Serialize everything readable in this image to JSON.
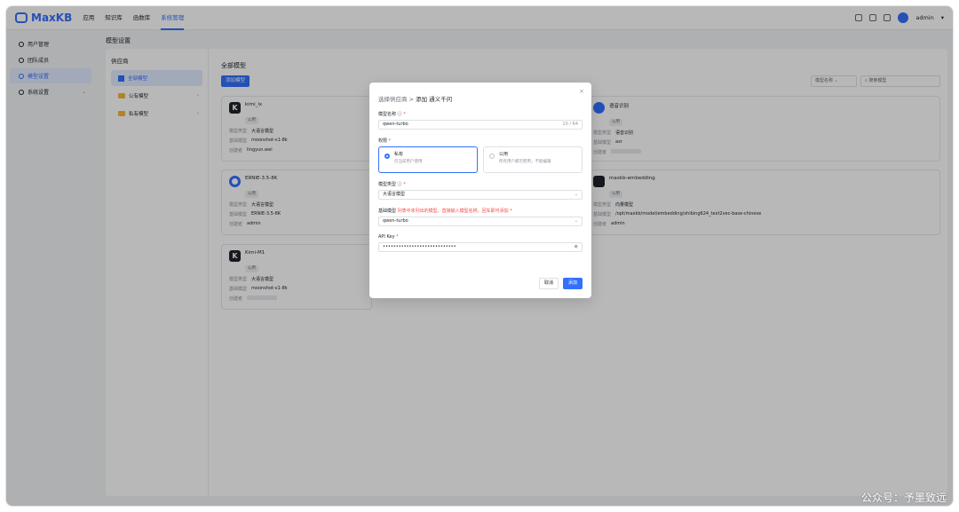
{
  "app": {
    "logo": "MaxKB"
  },
  "topnav": [
    "应用",
    "知识库",
    "函数库",
    "系统管理"
  ],
  "user": {
    "name": "admin"
  },
  "sidebar": {
    "items": [
      {
        "label": "用户管理"
      },
      {
        "label": "团队成员"
      },
      {
        "label": "模型设置"
      },
      {
        "label": "系统设置"
      }
    ]
  },
  "page_title": "模型设置",
  "providers": {
    "title": "供应商",
    "items": [
      {
        "label": "全部模型"
      },
      {
        "label": "公有模型"
      },
      {
        "label": "私有模型"
      }
    ]
  },
  "models": {
    "heading": "全部模型",
    "add_label": "添加模型",
    "filter_label": "模型名称",
    "search_placeholder": "搜索模型",
    "cards": [
      {
        "logo": "K",
        "name": "kimi_lx",
        "tag": "公用",
        "type": "大语言模型",
        "base": "moonshot-v1-8k",
        "creator": "lingyun.wei"
      },
      {
        "logo": "",
        "name": "ERNIE-3.5-8K",
        "tag": "公用",
        "type": "大语言模型",
        "base": "ERNIE-3.5-8K",
        "creator": "admin"
      },
      {
        "logo": "K",
        "name": "Kimi-M1",
        "tag": "公用",
        "type": "大语言模型",
        "base": "moonshot-v1-8k",
        "creator": ""
      },
      {
        "logo": "",
        "name": "语音识别",
        "tag": "公用",
        "type": "语音识别",
        "base": "asr",
        "creator": ""
      },
      {
        "logo": "",
        "name": "maxkb-embedding",
        "tag": "公用",
        "type": "向量模型",
        "base": "/opt/maxkb/model/embedding/shibing624_text2vec-base-chinese",
        "creator": "admin"
      }
    ],
    "row_labels": {
      "type": "模型类型",
      "base": "基础模型",
      "creator": "创建者"
    }
  },
  "dialog": {
    "crumb": "选择供应商",
    "sep": ">",
    "title": "添加 通义千问",
    "name_label": "模型名称",
    "name_value": "qwen-turbo",
    "name_count": "10 / 64",
    "perm_label": "权限",
    "perm_private_title": "私有",
    "perm_private_desc": "仅当前用户使用",
    "perm_public_title": "公用",
    "perm_public_desc": "所有用户都可使用，不能编辑",
    "type_label": "模型类型",
    "type_value": "大语言模型",
    "base_label": "基础模型",
    "base_hint": "列表中未列出的模型，直接输入模型名称，回车即可添加",
    "base_value": "qwen-turbo",
    "key_label": "API Key",
    "key_value": "••••••••••••••••••••••••••••",
    "cancel": "取消",
    "confirm": "添加"
  },
  "watermark": "公众号：予墨致远"
}
